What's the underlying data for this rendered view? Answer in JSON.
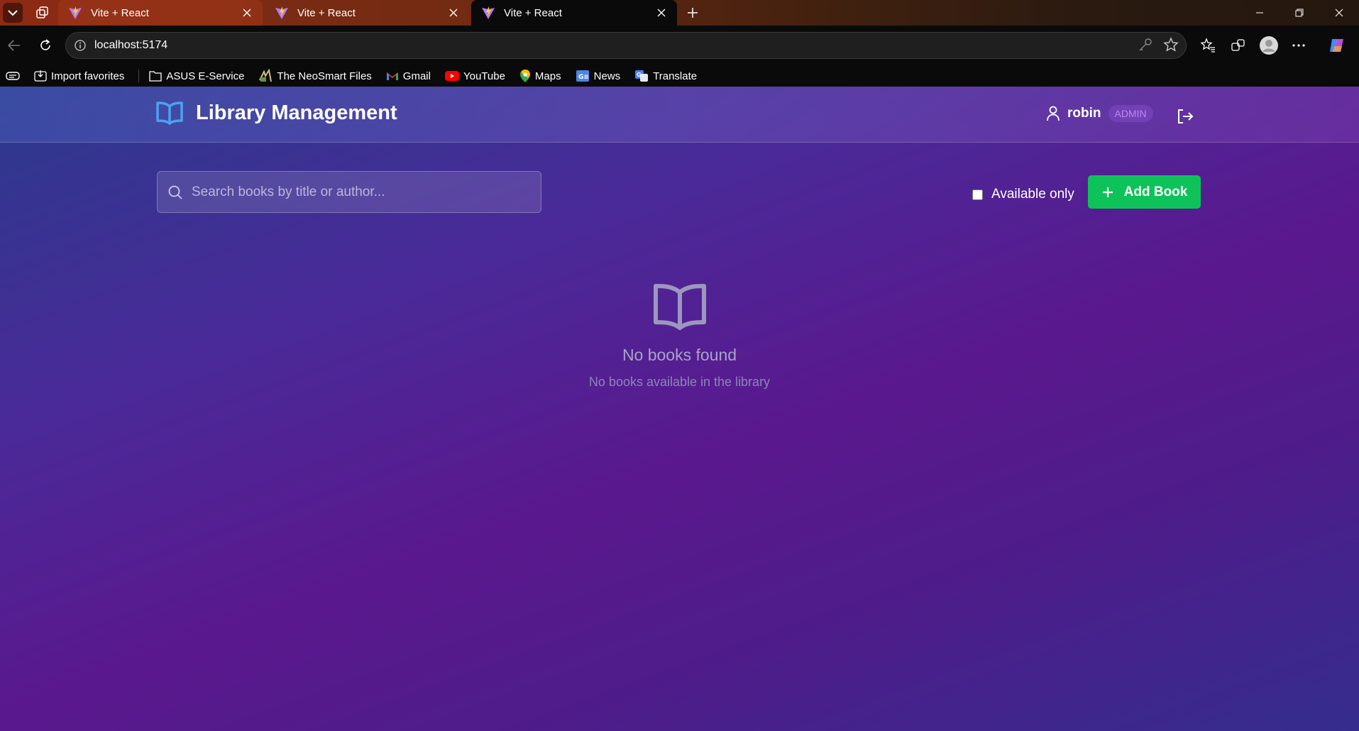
{
  "browser": {
    "tabs": [
      {
        "title": "Vite + React",
        "active": false
      },
      {
        "title": "Vite + React",
        "active": false
      },
      {
        "title": "Vite + React",
        "active": true
      }
    ],
    "url": "localhost:5174",
    "bookmarks": [
      {
        "label": "Import favorites",
        "icon": "import-icon"
      },
      {
        "label": "ASUS E-Service",
        "icon": "folder-icon"
      },
      {
        "label": "The NeoSmart Files",
        "icon": "neosmart-icon"
      },
      {
        "label": "Gmail",
        "icon": "gmail-icon"
      },
      {
        "label": "YouTube",
        "icon": "youtube-icon"
      },
      {
        "label": "Maps",
        "icon": "maps-icon"
      },
      {
        "label": "News",
        "icon": "news-icon"
      },
      {
        "label": "Translate",
        "icon": "translate-icon"
      }
    ]
  },
  "header": {
    "title": "Library Management",
    "user_name": "robin",
    "role": "ADMIN"
  },
  "toolbar": {
    "search_placeholder": "Search books by title or author...",
    "filter_label": "Available only",
    "add_label": "Add Book"
  },
  "empty_state": {
    "title": "No books found",
    "subtitle": "No books available in the library"
  },
  "colors": {
    "accent_green": "#0ec25a",
    "brand_icon": "#4aa3f0",
    "badge_text": "#b98af0"
  }
}
